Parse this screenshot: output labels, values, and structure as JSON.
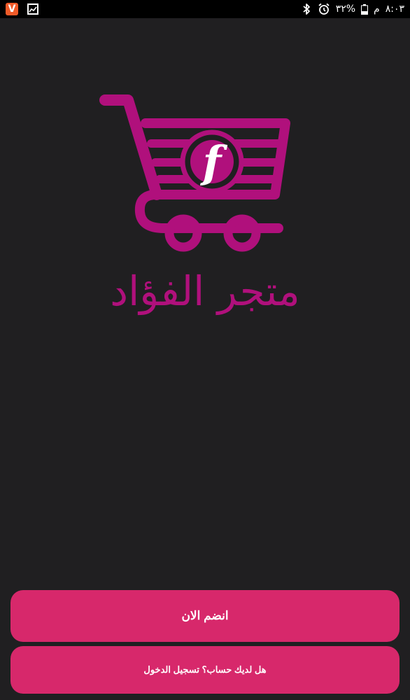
{
  "status_bar": {
    "time": "٨:٠٣",
    "ampm": "م",
    "battery_text": "٣٢%",
    "icons": [
      "vivaldi-notification-icon",
      "gallery-notification-icon",
      "bluetooth-icon",
      "alarm-icon",
      "battery-icon"
    ]
  },
  "brand": {
    "logo_letter": "f",
    "name": "متجر الفؤاد",
    "color": "#b0107c"
  },
  "buttons": {
    "join_label": "انضم الان",
    "login_label": "هل لديك حساب؟ تسجيل الدخول",
    "color": "#d7286b"
  },
  "colors": {
    "background": "#201f21",
    "status_bar": "#000000"
  }
}
